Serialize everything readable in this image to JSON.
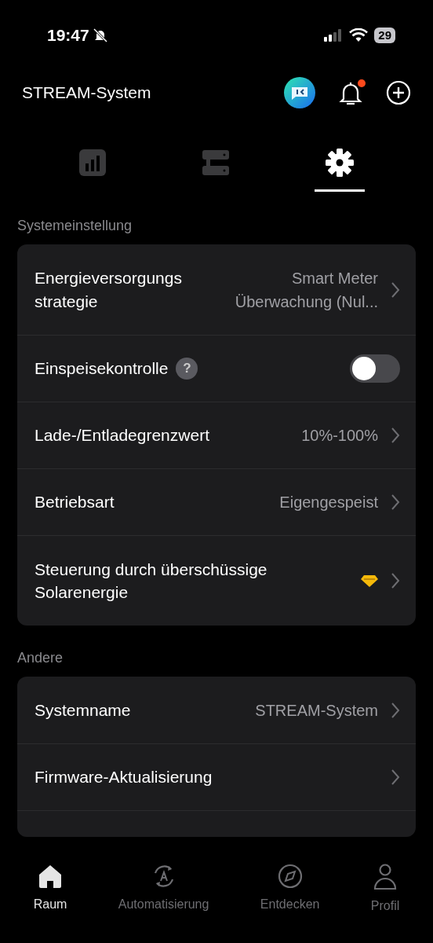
{
  "status_bar": {
    "time": "19:47",
    "battery": "29"
  },
  "header": {
    "title": "STREAM-System",
    "notification_badge": true
  },
  "tabs": [
    {
      "kind": "chart",
      "selected": false
    },
    {
      "kind": "devices",
      "selected": false
    },
    {
      "kind": "settings",
      "selected": true
    }
  ],
  "sections": [
    {
      "title": "Systemeinstellung",
      "items": [
        {
          "kind": "link",
          "label": "Energieversorgungs strategie",
          "value": "Smart Meter Überwachung (Nul..."
        },
        {
          "kind": "toggle",
          "label": "Einspeisekontrolle",
          "help": "?",
          "on": false
        },
        {
          "kind": "link",
          "label": "Lade-/Entladegrenzwert",
          "value": "10%-100%"
        },
        {
          "kind": "link",
          "label": "Betriebsart",
          "value": "Eigengespeist"
        },
        {
          "kind": "premium",
          "label": "Steuerung durch überschüssige Solarenergie"
        }
      ]
    },
    {
      "title": "Andere",
      "items": [
        {
          "kind": "link",
          "label": "Systemname",
          "value": "STREAM-System"
        },
        {
          "kind": "link",
          "label": "Firmware-Aktualisierung"
        }
      ]
    }
  ],
  "bottom_nav": [
    {
      "kind": "home",
      "label": "Raum",
      "selected": true
    },
    {
      "kind": "automation",
      "label": "Automatisierung",
      "selected": false
    },
    {
      "kind": "compass",
      "label": "Entdecken",
      "selected": false
    },
    {
      "kind": "person",
      "label": "Profil",
      "selected": false
    }
  ]
}
